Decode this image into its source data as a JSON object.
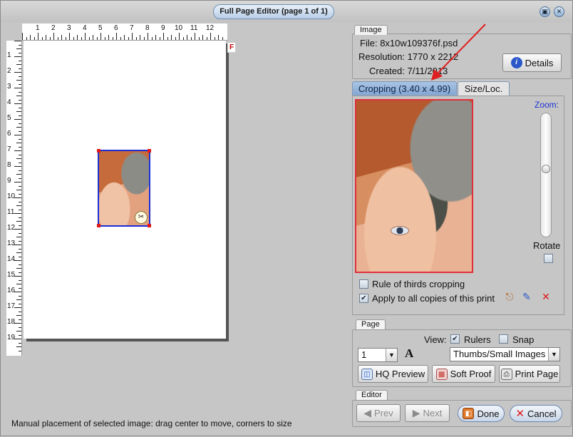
{
  "window": {
    "title": "Full Page Editor (page 1 of 1)"
  },
  "rulers": {
    "top_numbers": [
      "1",
      "2",
      "3",
      "4",
      "5",
      "6",
      "7",
      "8",
      "9",
      "10",
      "11",
      "12"
    ],
    "left_numbers": [
      "1",
      "2",
      "3",
      "4",
      "5",
      "6",
      "7",
      "8",
      "9",
      "10",
      "11",
      "12",
      "13",
      "14",
      "15",
      "16",
      "17",
      "18",
      "19"
    ]
  },
  "page_marker": "F",
  "image_group": {
    "tab": "Image",
    "file_label": "File:",
    "file": "8x10w109376f.psd",
    "resolution_label": "Resolution:",
    "resolution": "1770 x 2212",
    "created_label": "Created:",
    "created": "7/11/2013",
    "details_button": "Details"
  },
  "tabs": [
    {
      "label": "Cropping (3.40 x 4.99)",
      "active": true
    },
    {
      "label": "Size/Loc.",
      "active": false
    }
  ],
  "cropping": {
    "zoom_label": "Zoom:",
    "zoom_level": 0.45,
    "rotate_label": "Rotate",
    "rule_of_thirds": {
      "label": "Rule of thirds cropping",
      "checked": false
    },
    "apply_all": {
      "label": "Apply to all copies of this print",
      "checked": true
    }
  },
  "page_group": {
    "tab": "Page",
    "view_label": "View:",
    "rulers": {
      "label": "Rulers",
      "checked": true
    },
    "snap": {
      "label": "Snap",
      "checked": false
    },
    "page_select": "1",
    "text_tool": "A",
    "view_select": "Thumbs/Small Images",
    "hq_preview": "HQ Preview",
    "soft_proof": "Soft Proof",
    "print_page": "Print Page"
  },
  "editor_group": {
    "tab": "Editor",
    "prev": "Prev",
    "next": "Next",
    "done": "Done",
    "cancel": "Cancel"
  },
  "status": "Manual placement of selected image: drag center to move, corners to size",
  "colors": {
    "accent_blue": "#1a32d0",
    "crop_border": "#e0303a",
    "photo_border": "#1a2fd6",
    "annotation_arrow": "#e02020"
  }
}
